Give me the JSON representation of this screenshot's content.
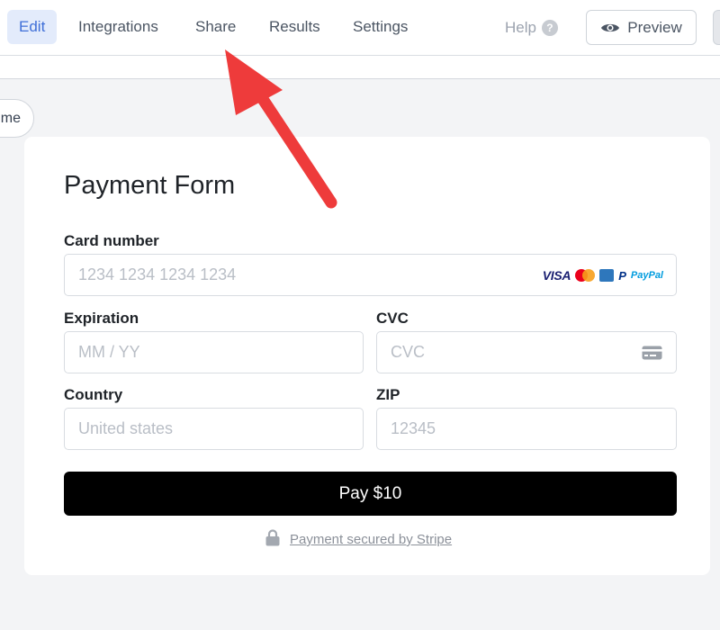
{
  "nav": {
    "tabs": [
      "Edit",
      "Integrations",
      "Share",
      "Results",
      "Settings"
    ],
    "active_tab": "Edit",
    "help_label": "Help",
    "help_badge": "?",
    "preview_label": "Preview",
    "preview_icon": "eye-icon"
  },
  "side_pill": {
    "label": "me"
  },
  "form": {
    "title": "Payment Form",
    "card_number": {
      "label": "Card number",
      "placeholder": "1234 1234 1234 1234",
      "brands": [
        "VISA",
        "mastercard-icon",
        "amex-icon",
        "P",
        "PayPal"
      ]
    },
    "expiration": {
      "label": "Expiration",
      "placeholder": "MM / YY"
    },
    "cvc": {
      "label": "CVC",
      "placeholder": "CVC",
      "icon": "card-icon"
    },
    "country": {
      "label": "Country",
      "placeholder": "United states"
    },
    "zip": {
      "label": "ZIP",
      "placeholder": "12345"
    },
    "pay_button": "Pay $10",
    "secured_text": "Payment secured by Stripe",
    "secured_icon": "lock-icon"
  },
  "annotation": {
    "icon": "red-arrow-icon",
    "color": "#ee3b3b"
  },
  "colors": {
    "accent": "#3f6fd8",
    "active_tab_bg": "#e3ebfb",
    "pay_button_bg": "#000000"
  }
}
